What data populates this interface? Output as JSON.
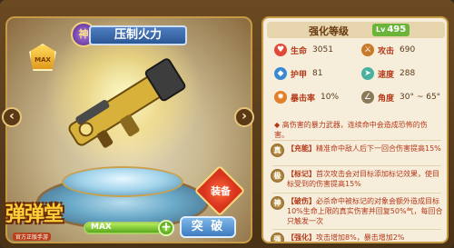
{
  "colors": {
    "accent": "#c79a45",
    "stat_name": "#b53a1a",
    "level_badge": "#6ab43a",
    "progress": "#5aa61e"
  },
  "weapon": {
    "name": "压制火力",
    "rank_badge": "神",
    "max_badge": "MAX",
    "equip_label": "装备"
  },
  "nav": {
    "prev_icon": "chevron-left-icon",
    "next_icon": "chevron-right-icon"
  },
  "logo": {
    "title": "弹弹堂",
    "subtitle": "官方正版手游"
  },
  "progress": {
    "label": "MAX",
    "fill": 1.0
  },
  "breakthrough_label": "突 破",
  "panel": {
    "header_label": "强化等级",
    "level_tag": "Lv",
    "level_value": "495",
    "stats": [
      {
        "icon": "heart-icon",
        "name": "生命",
        "value": "3051",
        "color": "#e04a3a"
      },
      {
        "icon": "sword-icon",
        "name": "攻击",
        "value": "690",
        "color": "#c77a2a"
      },
      {
        "icon": "shield-icon",
        "name": "护甲",
        "value": "81",
        "color": "#3a8ad0"
      },
      {
        "icon": "wing-icon",
        "name": "速度",
        "value": "288",
        "color": "#4ab0a0"
      },
      {
        "icon": "target-icon",
        "name": "暴击率",
        "value": "10%",
        "color": "#e0802a"
      },
      {
        "icon": "angle-icon",
        "name": "角度",
        "value": "30° ~ 65°",
        "color": "#8a7a5a"
      }
    ],
    "description": "◆ 高伤害的暴力武器，连续命中会造成恐怖的伤害。",
    "skills": [
      {
        "icon": "真",
        "tag": "【充能】",
        "text": "精准命中敌人后下一回合伤害提高15%"
      },
      {
        "icon": "极",
        "tag": "【标记】",
        "text": "首次攻击会对目标添加标记效果，使目标受到的伤害提高15%"
      },
      {
        "icon": "神",
        "tag": "【破伤】",
        "text": "必杀命中被标记的对象会额外造成目标10%生命上限的真实伤害并回复50%气，每回合只触发一次"
      },
      {
        "icon": "强",
        "tag": "【强化】",
        "text": "攻击增加8%，暴击增加2%"
      }
    ]
  }
}
